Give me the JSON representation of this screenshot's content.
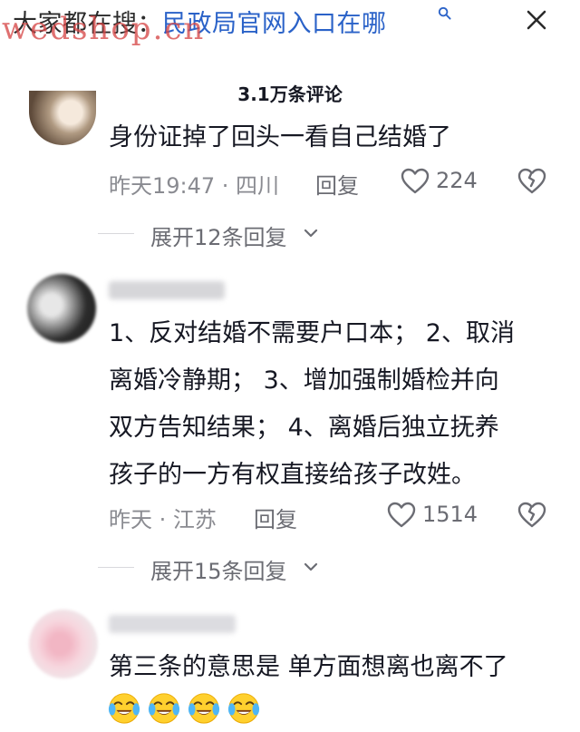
{
  "top_bar": {
    "search_prefix": "大家都在搜：",
    "search_query": "民政局官网入口在哪",
    "close_icon": "close-icon"
  },
  "watermark": "wedshop.cn",
  "comments_header": {
    "count_label": "3.1万条评论"
  },
  "comments": [
    {
      "text_lines": [
        "身份证掉了回头一看自己结婚了"
      ],
      "meta": "昨天19:47 · 四川",
      "reply_label": "回复",
      "likes": "224",
      "expand_label": "展开12条回复"
    },
    {
      "text_lines": [
        "1、反对结婚不需要户口本； 2、取消",
        "离婚冷静期； 3、增加强制婚检并向",
        "双方告知结果； 4、离婚后独立抚养",
        "孩子的一方有权直接给孩子改姓。"
      ],
      "meta": "昨天 · 江苏",
      "reply_label": "回复",
      "likes": "1514",
      "expand_label": "展开15条回复"
    },
    {
      "text_lines": [
        "第三条的意思是 单方面想离也离不了"
      ],
      "emojis": [
        "crying-laughing-emoji",
        "crying-laughing-emoji",
        "crying-laughing-emoji",
        "crying-laughing-emoji"
      ]
    }
  ],
  "colors": {
    "link_blue": "#2a62c8",
    "meta_gray": "#8a8b91",
    "text_dark": "#161823",
    "watermark_red": "#d64848"
  }
}
